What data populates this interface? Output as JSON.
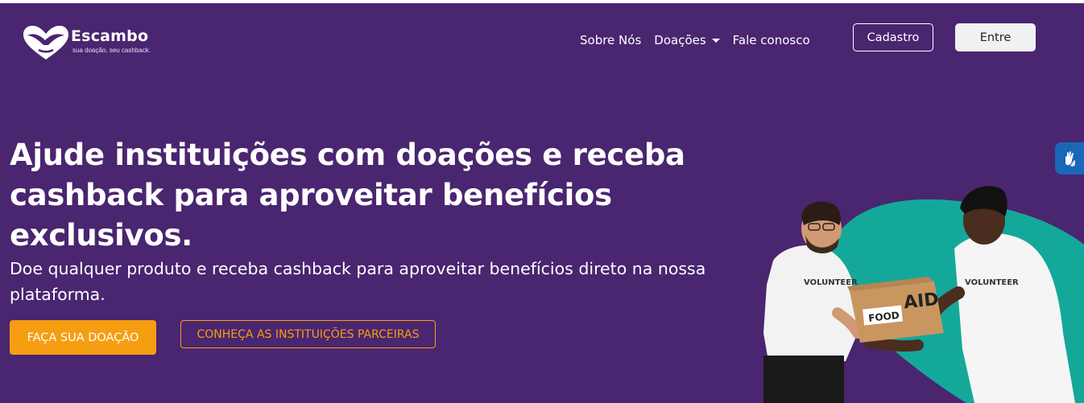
{
  "brand": {
    "name": "Escambo",
    "tagline": "sua doação, seu cashback."
  },
  "nav": {
    "about": "Sobre Nós",
    "donations": "Doações",
    "contact": "Fale conosco",
    "signup": "Cadastro",
    "login": "Entre"
  },
  "hero": {
    "headline": "Ajude instituições com doações e receba cashback para aproveitar benefícios exclusivos.",
    "subheadline": "Doe qualquer produto e receba cashback para aproveitar benefícios direto na nossa plataforma.",
    "cta_primary": "FAÇA SUA DOAÇÃO",
    "cta_secondary": "CONHEÇA AS INSTITUIÇÕES PARCEIRAS"
  },
  "illustration": {
    "shirt_text_left": "VOLUNTEER",
    "shirt_text_right": "VOLUNTEER",
    "box_label": "FOOD",
    "box_marking": "AID"
  },
  "icons": {
    "accessibility": "hands-sign-language-icon",
    "logo": "heart-hands-icon",
    "dropdown": "caret-down-icon"
  },
  "colors": {
    "background": "#4a2570",
    "accent": "#f59e12",
    "blob": "#14a89a",
    "widget": "#1b66b8"
  }
}
